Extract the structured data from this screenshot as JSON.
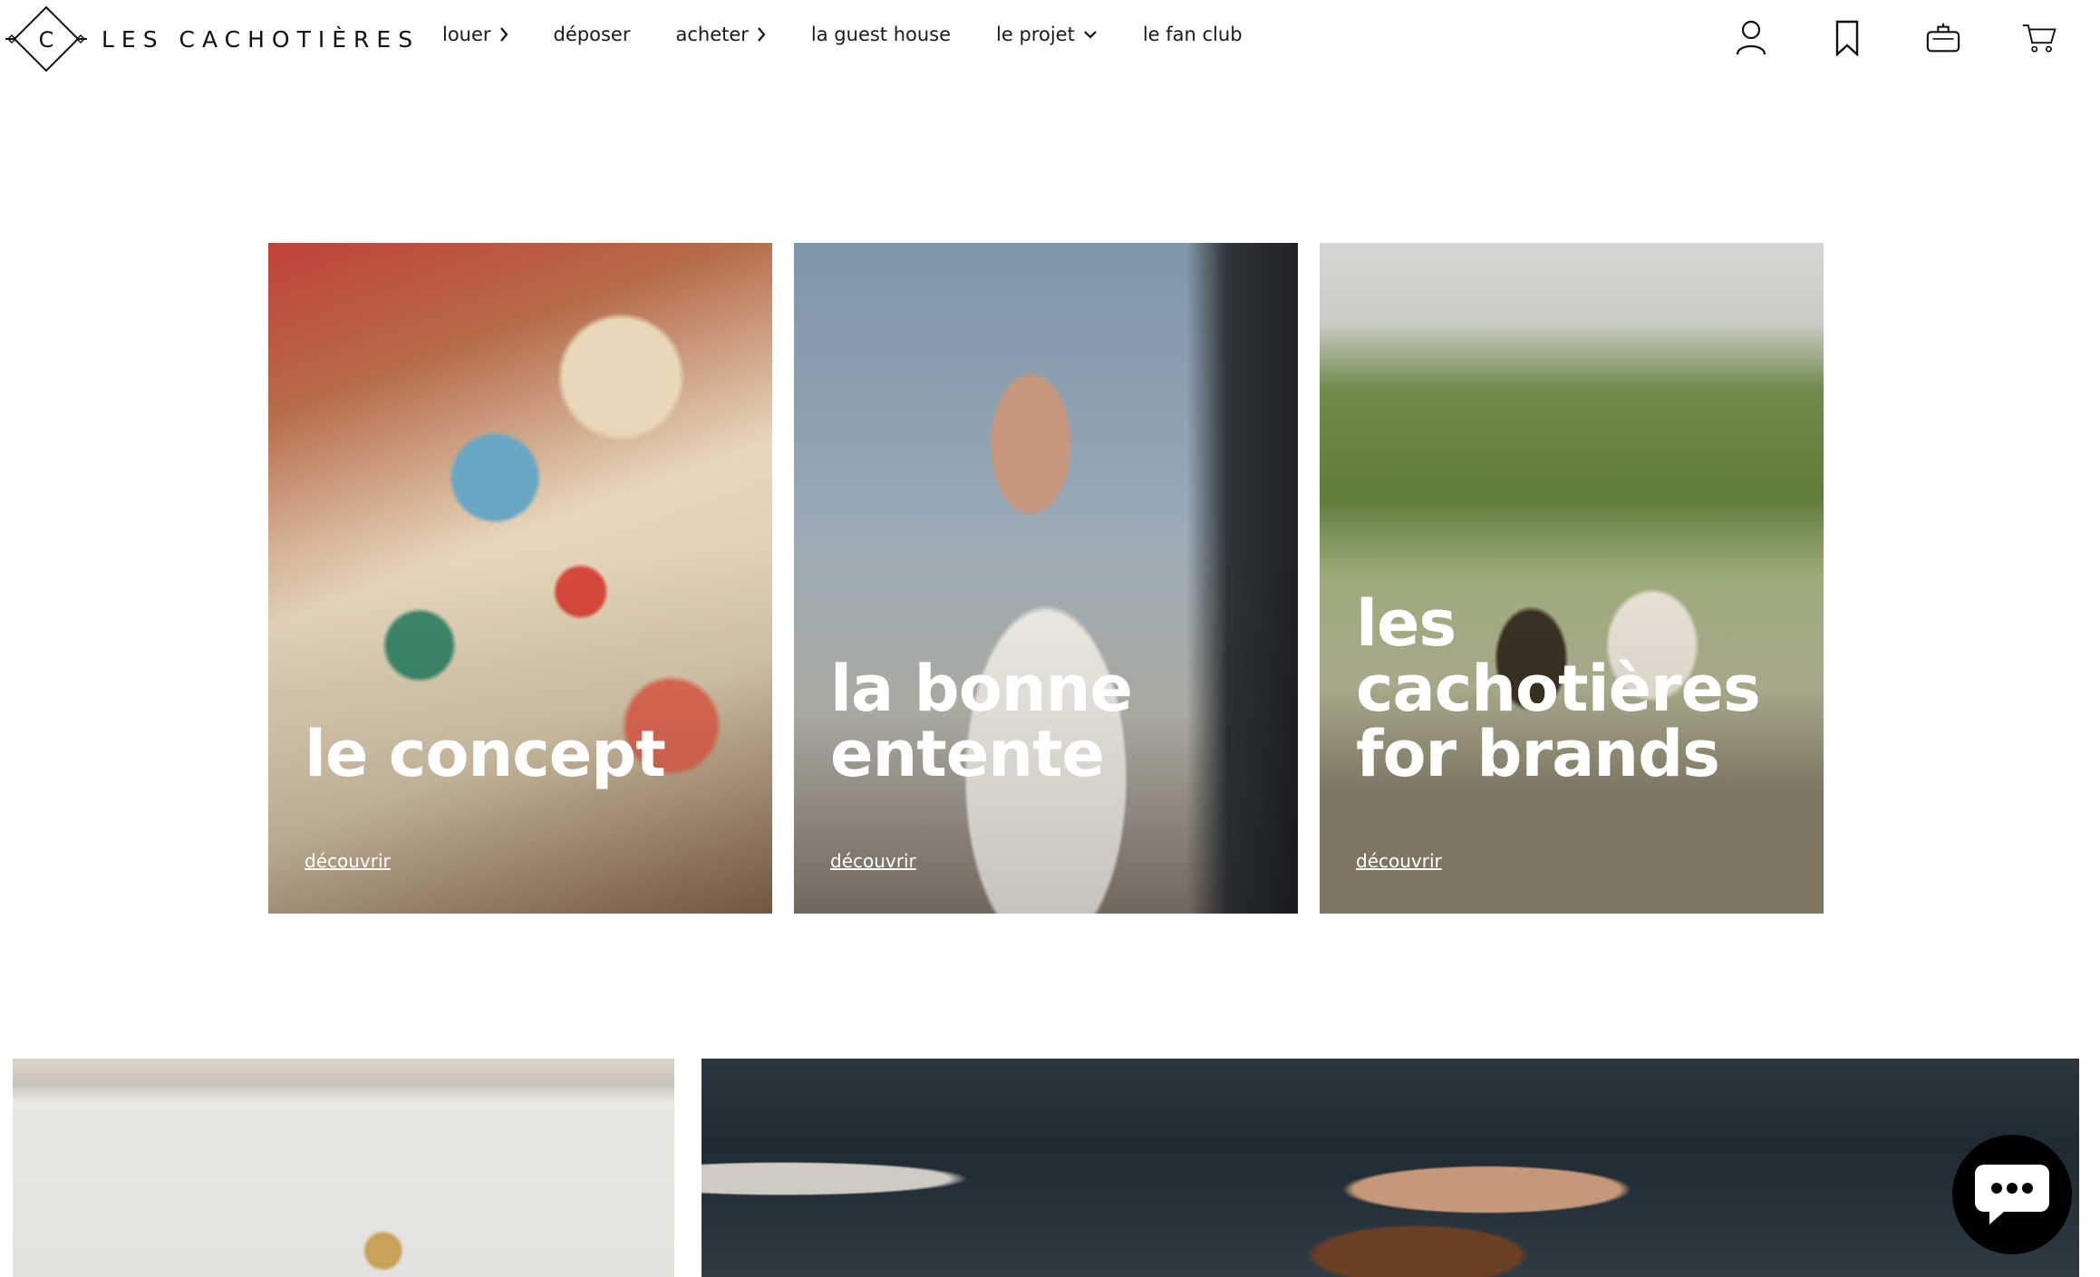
{
  "header": {
    "logo_letter": "C",
    "brand": "LES CACHOTIÈRES",
    "nav": [
      {
        "label": "louer",
        "has_arrow": true
      },
      {
        "label": "déposer"
      },
      {
        "label": "acheter",
        "has_arrow": true
      },
      {
        "label": "la guest house"
      },
      {
        "label": "le projet",
        "has_dropdown": true
      },
      {
        "label": "le fan club"
      }
    ],
    "icons": [
      "user-icon",
      "bookmark-icon",
      "bag-icon",
      "cart-icon"
    ]
  },
  "tiles": [
    {
      "title": "le concept",
      "link": "découvrir"
    },
    {
      "title": "la bonne entente",
      "link": "découvrir"
    },
    {
      "title": "les cachotières for brands",
      "link": "découvrir"
    }
  ],
  "chat": {
    "icon": "chat-icon"
  }
}
